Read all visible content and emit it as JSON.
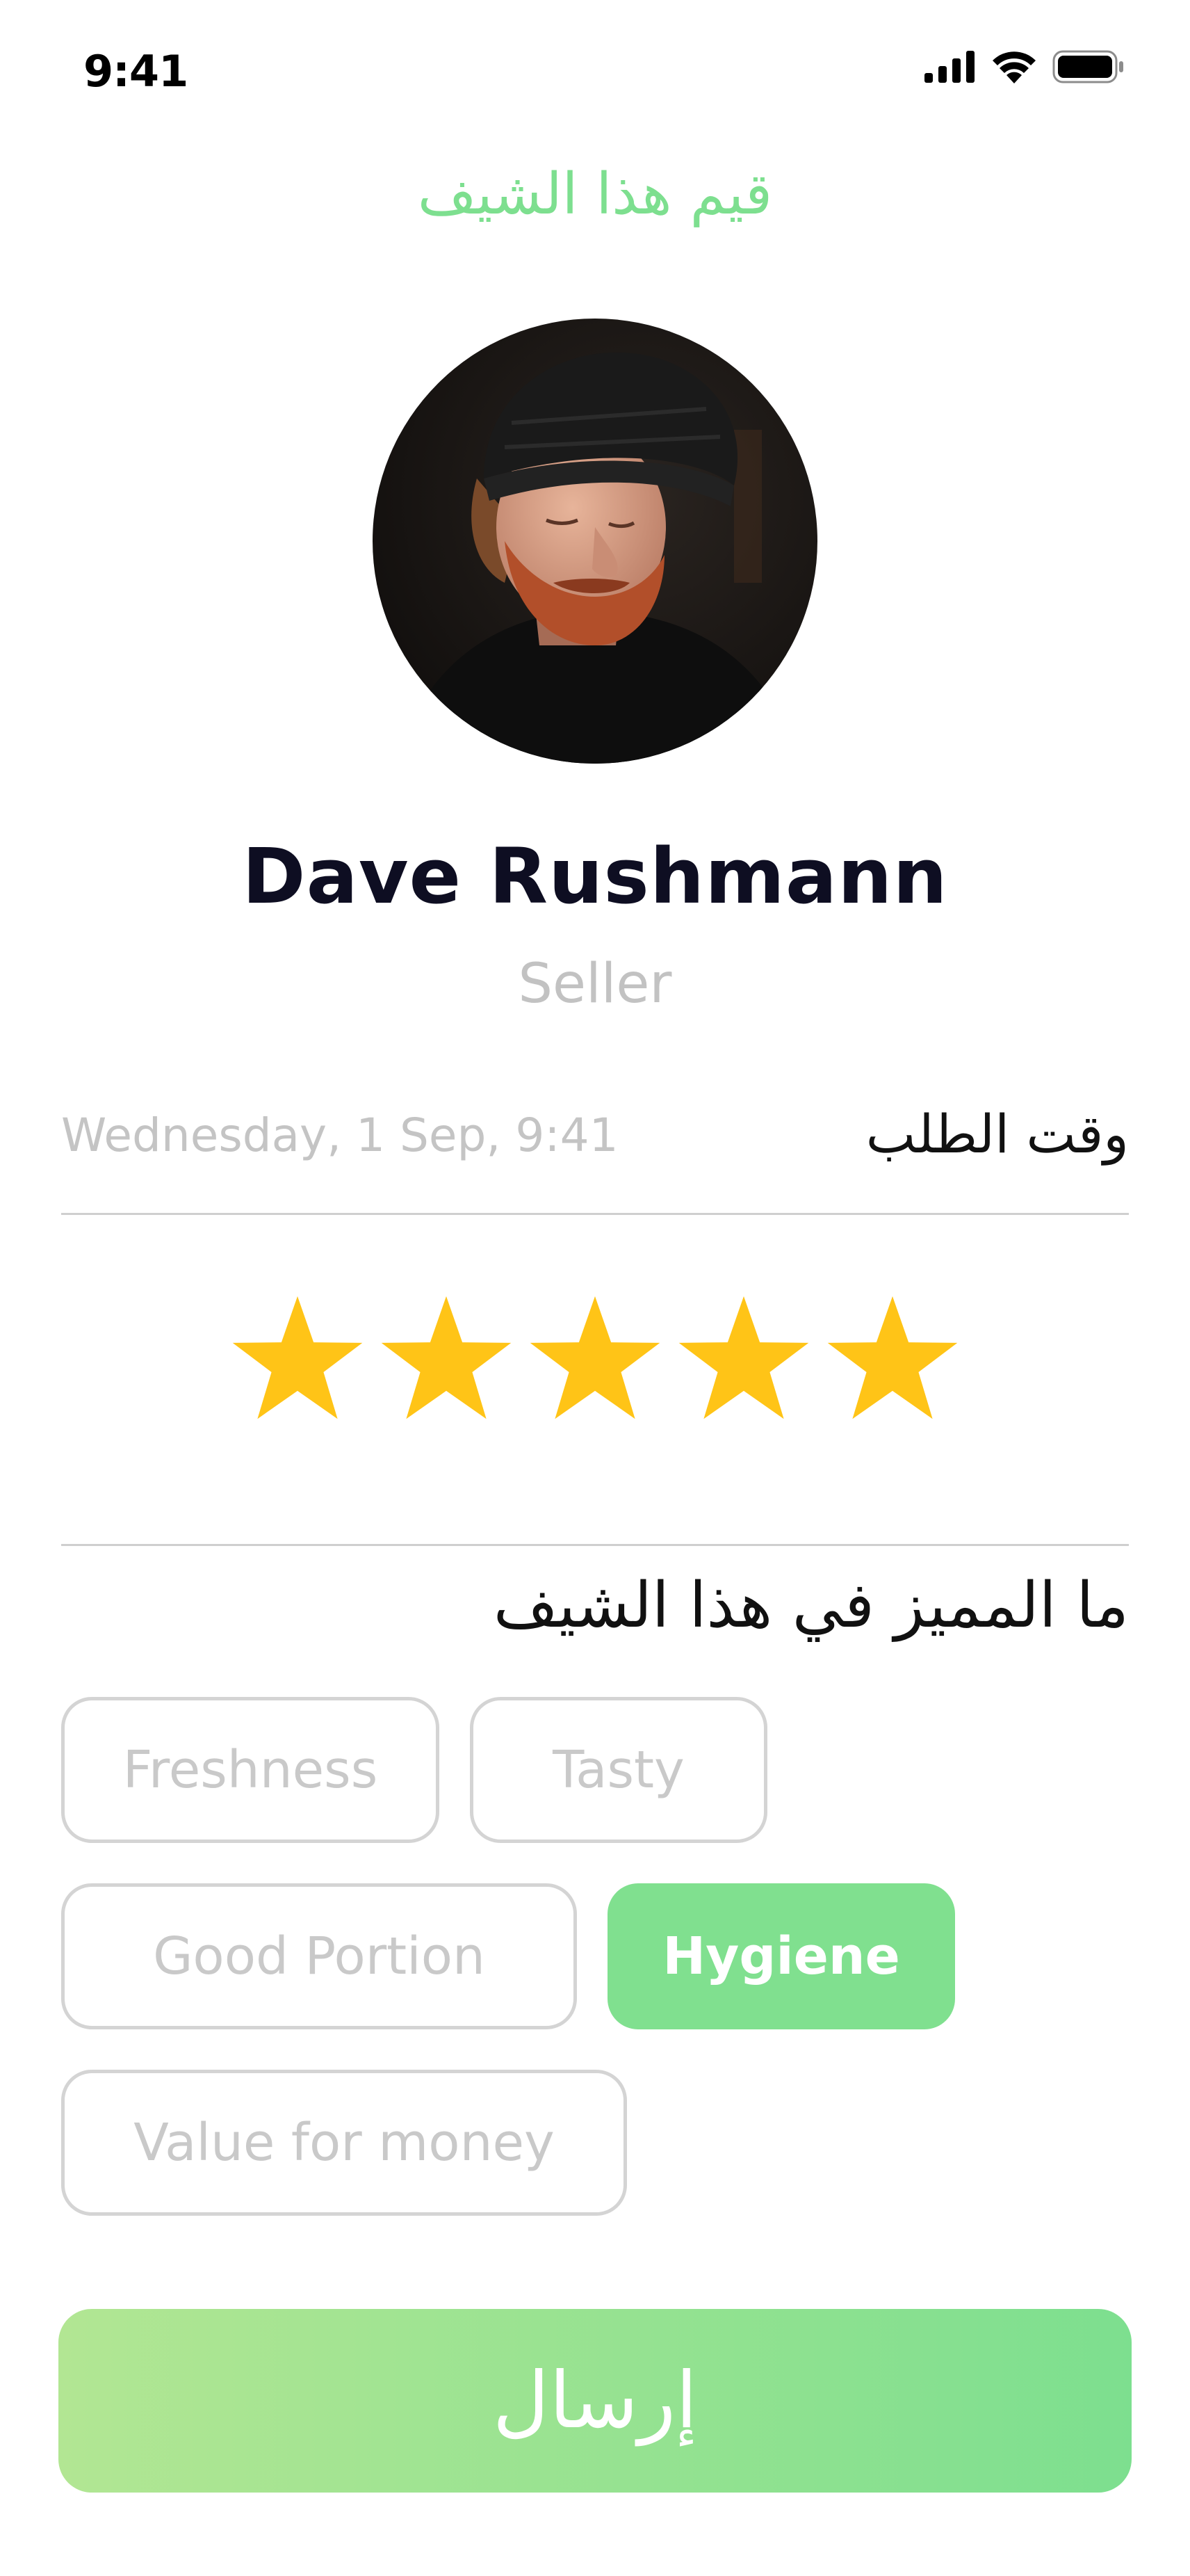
{
  "status_bar": {
    "time": "9:41",
    "icons": [
      "cellular-signal-icon",
      "wifi-icon",
      "battery-icon"
    ]
  },
  "header": {
    "title": "قيم هذا الشيف"
  },
  "chef": {
    "avatar": "chef-photo",
    "name": "Dave Rushmann",
    "role": "Seller"
  },
  "order": {
    "label": "وقت الطلب",
    "date": "Wednesday, 1 Sep, 9:41"
  },
  "rating": {
    "value": 5,
    "max": 5,
    "star_color": "#ffc417"
  },
  "highlights": {
    "question": "ما المميز في هذا الشيف",
    "tags": [
      {
        "label": "Freshness",
        "selected": false
      },
      {
        "label": "Tasty",
        "selected": false
      },
      {
        "label": "Good Portion",
        "selected": false
      },
      {
        "label": "Hygiene",
        "selected": true
      },
      {
        "label": "Value for money",
        "selected": false
      }
    ]
  },
  "submit": {
    "label": "إرسال"
  },
  "colors": {
    "accent": "#7ddf8f",
    "accent_light": "#b2e693",
    "star": "#ffc417",
    "muted_text": "#c4c4c4"
  }
}
